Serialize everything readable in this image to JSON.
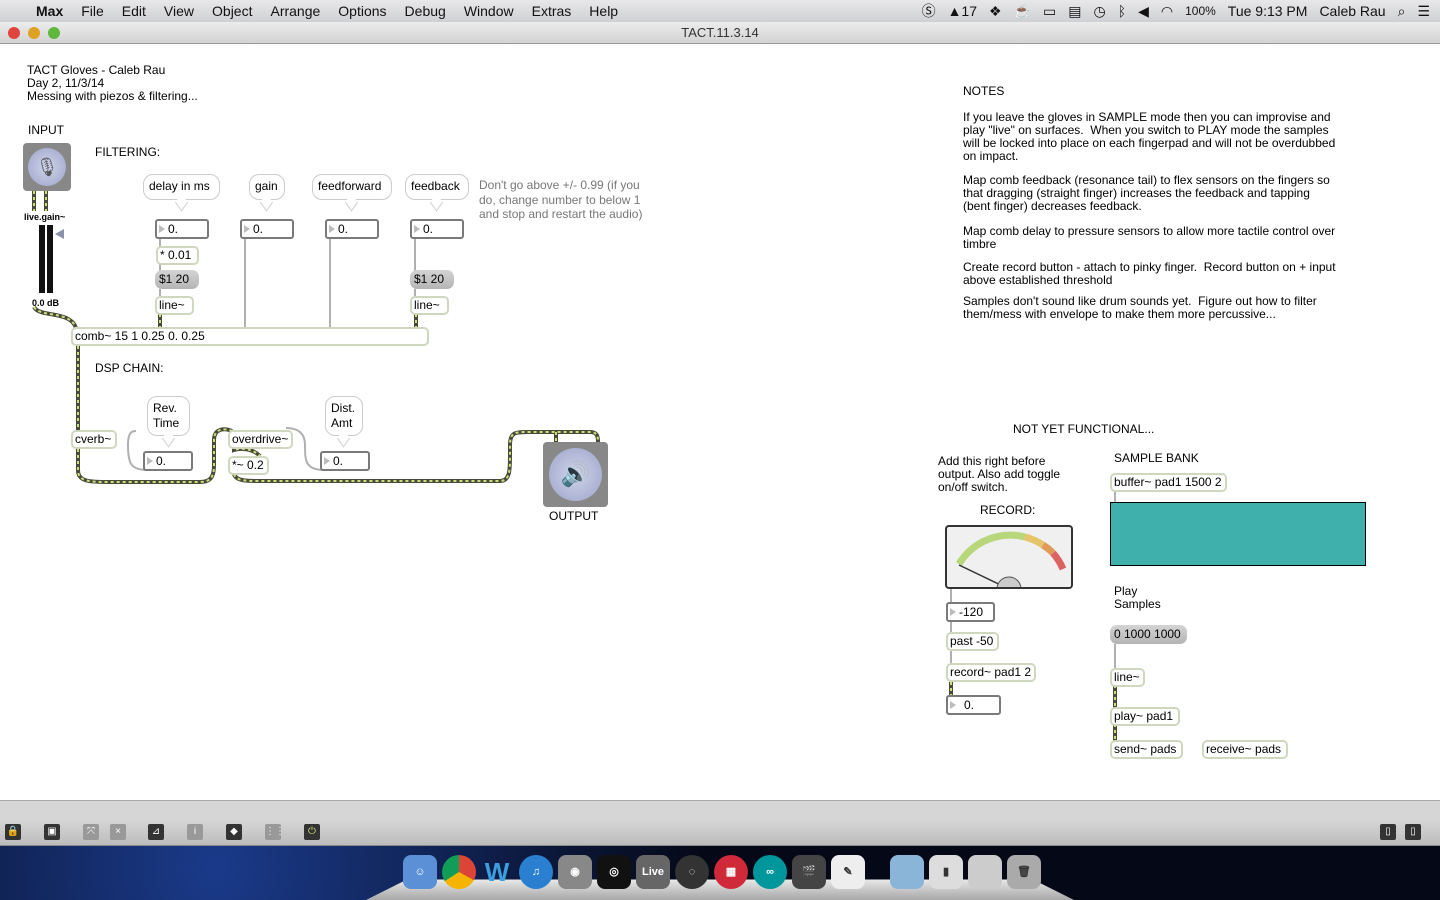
{
  "menubar": {
    "apple": "",
    "app": "Max",
    "items": [
      "File",
      "Edit",
      "View",
      "Object",
      "Arrange",
      "Options",
      "Debug",
      "Window",
      "Extras",
      "Help"
    ],
    "status": {
      "notif": "17",
      "battery": "100%",
      "clock": "Tue 9:13 PM",
      "user": "Caleb Rau"
    }
  },
  "window": {
    "title": "TACT.11.3.14"
  },
  "patch": {
    "header": "TACT Gloves - Caleb Rau\nDay 2, 11/3/14\nMessing with piezos & filtering...",
    "input_label": "INPUT",
    "live_gain": "live.gain~",
    "gain_db": "0.0 dB",
    "filtering_label": "FILTERING:",
    "bubbles": [
      "delay in ms",
      "gain",
      "feedforward",
      "feedback"
    ],
    "number_values": [
      "0.",
      "0.",
      "0.",
      "0."
    ],
    "mult": "* 0.01",
    "msg_line": "$1 20",
    "line_obj": "line~",
    "comb": "comb~ 15 1 0.25 0. 0.25",
    "warning": "Don't go above +/- 0.99 (if you\ndo, change number to below 1\nand stop and restart the audio)",
    "dsp_label": "DSP CHAIN:",
    "cverb": "cverb~",
    "rev_time": "Rev.\nTime",
    "rev_value": "0.",
    "overdrive": "overdrive~",
    "mult2": "*~ 0.2",
    "dist_amt": "Dist.\nAmt",
    "dist_value": "0.",
    "output_label": "OUTPUT",
    "notes_title": "NOTES",
    "notes": [
      "If you leave the gloves in SAMPLE mode then you can improvise and\nplay \"live\" on surfaces.  When you switch to PLAY mode the samples\nwill be locked into place on each fingerpad and will not be overdubbed\non impact.",
      "Map comb feedback (resonance tail) to flex sensors on the fingers so\nthat dragging (straight finger) increases the feedback and tapping\n(bent finger) decreases feedback.",
      "Map comb delay to pressure sensors to allow more tactile control over\ntimbre",
      "Create record button - attach to pinky finger.  Record button on + input\nabove established threshold",
      "Samples don't sound like drum sounds yet.  Figure out how to filter\nthem/mess with envelope to make them more percussive..."
    ],
    "not_functional": "NOT YET FUNCTIONAL...",
    "add_note": "Add this right before\noutput. Also add toggle\non/off switch.",
    "record_label": "RECORD:",
    "thresh": "-120",
    "past": "past -50",
    "record": "record~ pad1 2",
    "sig_value": "0.",
    "sample_bank": "SAMPLE BANK",
    "buffer": "buffer~ pad1 1500 2",
    "buffer_color": "#3fb0ac",
    "play_label": "Play\nSamples",
    "play_msg": "0 1000 1000",
    "line2": "line~",
    "play": "play~ pad1",
    "send": "send~ pads",
    "receive": "receive~ pads"
  },
  "toolbar": {
    "icons": [
      "lock-icon",
      "new-view-icon",
      "patch-cords-icon",
      "close-x-icon",
      "presentation-icon",
      "inspector-icon",
      "object-icon",
      "grid-icon",
      "audio-dsp-icon"
    ]
  },
  "dock": {
    "apps": [
      "Finder",
      "Chrome",
      "Word",
      "iTunes",
      "Logic",
      "Ableton",
      "Live",
      "Maschine",
      "Teensy",
      "Arduino",
      "Final Cut",
      "Notes",
      "Folder",
      "Archive",
      "Preview",
      "Trash"
    ]
  }
}
